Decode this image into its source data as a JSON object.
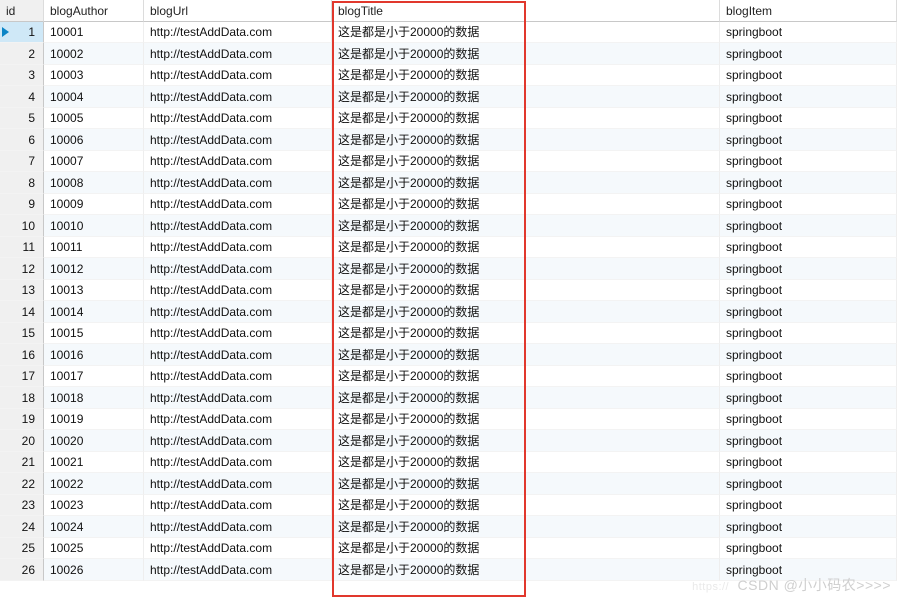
{
  "headers": {
    "id": "id",
    "blogAuthor": "blogAuthor",
    "blogUrl": "blogUrl",
    "blogTitle": "blogTitle",
    "blogItem": "blogItem"
  },
  "rows": [
    {
      "id": "1",
      "blogAuthor": "10001",
      "blogUrl": "http://testAddData.com",
      "blogTitle": "这是都是小于20000的数据",
      "blogItem": "springboot"
    },
    {
      "id": "2",
      "blogAuthor": "10002",
      "blogUrl": "http://testAddData.com",
      "blogTitle": "这是都是小于20000的数据",
      "blogItem": "springboot"
    },
    {
      "id": "3",
      "blogAuthor": "10003",
      "blogUrl": "http://testAddData.com",
      "blogTitle": "这是都是小于20000的数据",
      "blogItem": "springboot"
    },
    {
      "id": "4",
      "blogAuthor": "10004",
      "blogUrl": "http://testAddData.com",
      "blogTitle": "这是都是小于20000的数据",
      "blogItem": "springboot"
    },
    {
      "id": "5",
      "blogAuthor": "10005",
      "blogUrl": "http://testAddData.com",
      "blogTitle": "这是都是小于20000的数据",
      "blogItem": "springboot"
    },
    {
      "id": "6",
      "blogAuthor": "10006",
      "blogUrl": "http://testAddData.com",
      "blogTitle": "这是都是小于20000的数据",
      "blogItem": "springboot"
    },
    {
      "id": "7",
      "blogAuthor": "10007",
      "blogUrl": "http://testAddData.com",
      "blogTitle": "这是都是小于20000的数据",
      "blogItem": "springboot"
    },
    {
      "id": "8",
      "blogAuthor": "10008",
      "blogUrl": "http://testAddData.com",
      "blogTitle": "这是都是小于20000的数据",
      "blogItem": "springboot"
    },
    {
      "id": "9",
      "blogAuthor": "10009",
      "blogUrl": "http://testAddData.com",
      "blogTitle": "这是都是小于20000的数据",
      "blogItem": "springboot"
    },
    {
      "id": "10",
      "blogAuthor": "10010",
      "blogUrl": "http://testAddData.com",
      "blogTitle": "这是都是小于20000的数据",
      "blogItem": "springboot"
    },
    {
      "id": "11",
      "blogAuthor": "10011",
      "blogUrl": "http://testAddData.com",
      "blogTitle": "这是都是小于20000的数据",
      "blogItem": "springboot"
    },
    {
      "id": "12",
      "blogAuthor": "10012",
      "blogUrl": "http://testAddData.com",
      "blogTitle": "这是都是小于20000的数据",
      "blogItem": "springboot"
    },
    {
      "id": "13",
      "blogAuthor": "10013",
      "blogUrl": "http://testAddData.com",
      "blogTitle": "这是都是小于20000的数据",
      "blogItem": "springboot"
    },
    {
      "id": "14",
      "blogAuthor": "10014",
      "blogUrl": "http://testAddData.com",
      "blogTitle": "这是都是小于20000的数据",
      "blogItem": "springboot"
    },
    {
      "id": "15",
      "blogAuthor": "10015",
      "blogUrl": "http://testAddData.com",
      "blogTitle": "这是都是小于20000的数据",
      "blogItem": "springboot"
    },
    {
      "id": "16",
      "blogAuthor": "10016",
      "blogUrl": "http://testAddData.com",
      "blogTitle": "这是都是小于20000的数据",
      "blogItem": "springboot"
    },
    {
      "id": "17",
      "blogAuthor": "10017",
      "blogUrl": "http://testAddData.com",
      "blogTitle": "这是都是小于20000的数据",
      "blogItem": "springboot"
    },
    {
      "id": "18",
      "blogAuthor": "10018",
      "blogUrl": "http://testAddData.com",
      "blogTitle": "这是都是小于20000的数据",
      "blogItem": "springboot"
    },
    {
      "id": "19",
      "blogAuthor": "10019",
      "blogUrl": "http://testAddData.com",
      "blogTitle": "这是都是小于20000的数据",
      "blogItem": "springboot"
    },
    {
      "id": "20",
      "blogAuthor": "10020",
      "blogUrl": "http://testAddData.com",
      "blogTitle": "这是都是小于20000的数据",
      "blogItem": "springboot"
    },
    {
      "id": "21",
      "blogAuthor": "10021",
      "blogUrl": "http://testAddData.com",
      "blogTitle": "这是都是小于20000的数据",
      "blogItem": "springboot"
    },
    {
      "id": "22",
      "blogAuthor": "10022",
      "blogUrl": "http://testAddData.com",
      "blogTitle": "这是都是小于20000的数据",
      "blogItem": "springboot"
    },
    {
      "id": "23",
      "blogAuthor": "10023",
      "blogUrl": "http://testAddData.com",
      "blogTitle": "这是都是小于20000的数据",
      "blogItem": "springboot"
    },
    {
      "id": "24",
      "blogAuthor": "10024",
      "blogUrl": "http://testAddData.com",
      "blogTitle": "这是都是小于20000的数据",
      "blogItem": "springboot"
    },
    {
      "id": "25",
      "blogAuthor": "10025",
      "blogUrl": "http://testAddData.com",
      "blogTitle": "这是都是小于20000的数据",
      "blogItem": "springboot"
    },
    {
      "id": "26",
      "blogAuthor": "10026",
      "blogUrl": "http://testAddData.com",
      "blogTitle": "这是都是小于20000的数据",
      "blogItem": "springboot"
    }
  ],
  "selectedRowIndex": 0,
  "watermark": {
    "prefix": "https://",
    "main": "CSDN @小小码农>>>>"
  }
}
